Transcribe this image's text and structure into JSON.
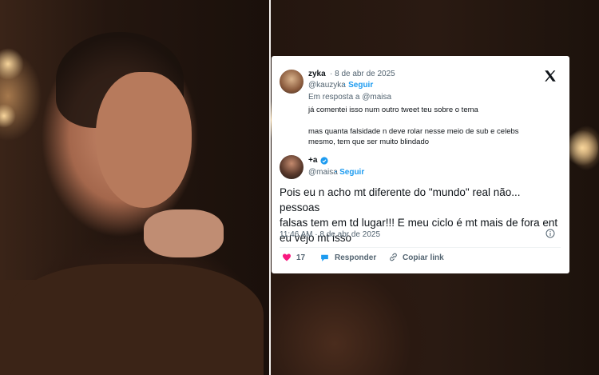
{
  "reply_tweet": {
    "display_name": "zyka",
    "handle": "@kauzyka",
    "date": "· 8 de abr de 2025",
    "follow_label": "· Seguir",
    "reply_context": "Em resposta a @maisa",
    "line1": "já comentei isso num outro tweet teu sobre o tema",
    "line2": "mas quanta falsidade n deve rolar nesse meio de sub e celebs",
    "line3": "mesmo, tem que ser muito blindado"
  },
  "main_tweet": {
    "display_name": "+a",
    "handle": "@maisa",
    "follow_label": "· Seguir",
    "text_line1": "Pois eu n acho mt diferente do \"mundo\" real não... pessoas",
    "text_line2": "falsas tem em td lugar!!! E meu ciclo é mt mais de fora ent",
    "text_line3": "eu vejo mt isso",
    "timestamp": "11:46 AM · 8 de abr de 2025",
    "likes": "17",
    "reply_label": "Responder",
    "copy_link_label": "Copiar link"
  },
  "colors": {
    "accent": "#1d9bf0",
    "like": "#f91880",
    "text": "#0f1419",
    "muted": "#536471"
  },
  "icons": [
    "x-logo-icon",
    "verified-badge-icon",
    "heart-icon",
    "reply-bubble-icon",
    "link-icon",
    "info-icon"
  ]
}
